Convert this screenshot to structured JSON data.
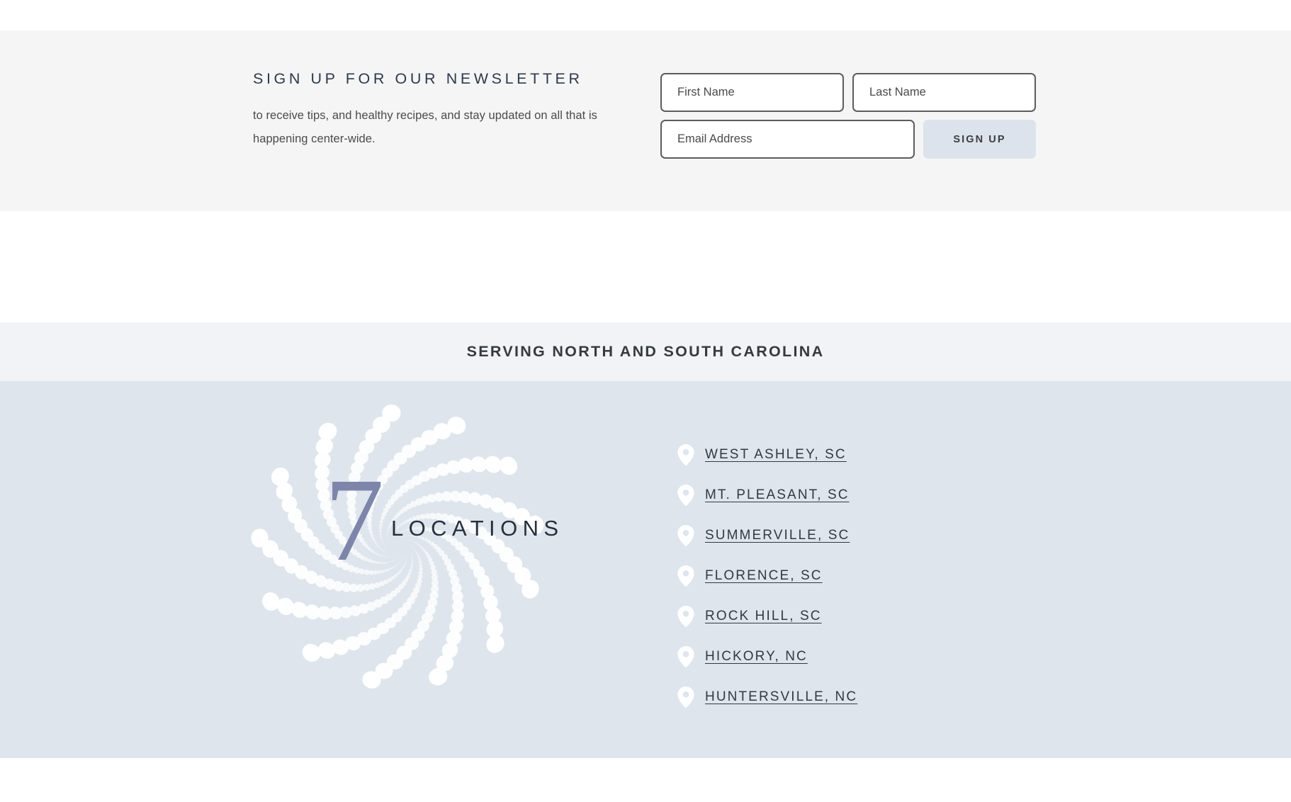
{
  "newsletter": {
    "heading": "SIGN UP FOR OUR NEWSLETTER",
    "subtext": "to receive tips, and healthy recipes, and stay updated on all that is happening center-wide.",
    "fields": {
      "first_name_placeholder": "First Name",
      "first_name_value": "",
      "last_name_placeholder": "Last Name",
      "last_name_value": "",
      "email_placeholder": "Email Address",
      "email_value": ""
    },
    "submit_label": "SIGN UP",
    "colors": {
      "band_background": "#f5f5f5",
      "heading_text": "#2c3a4d",
      "field_border": "#5c5c5c",
      "button_background": "#dde3ec",
      "button_text": "#3d3d3d"
    }
  },
  "serving_banner": {
    "title": "SERVING NORTH AND SOUTH CAROLINA",
    "background": "#f2f3f7",
    "text_color": "#343a40"
  },
  "locations_section": {
    "background": "#dfe5ec",
    "logo": {
      "number": "7",
      "word": "LOCATIONS",
      "number_color": "#7d85ab",
      "word_color": "#25303f",
      "dot_color": "#ffffff",
      "icon_name": "dotted-spiral-logo"
    },
    "list_icon": "map-pin-icon",
    "items": [
      {
        "label": "WEST ASHLEY, SC"
      },
      {
        "label": "MT. PLEASANT, SC"
      },
      {
        "label": "SUMMERVILLE, SC"
      },
      {
        "label": "FLORENCE, SC"
      },
      {
        "label": "ROCK HILL, SC"
      },
      {
        "label": "HICKORY, NC"
      },
      {
        "label": "HUNTERSVILLE, NC"
      }
    ]
  }
}
